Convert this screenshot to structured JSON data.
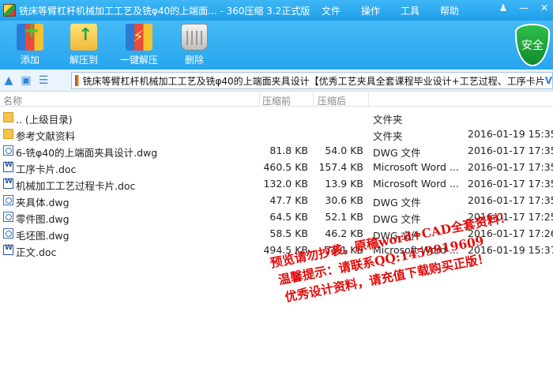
{
  "window": {
    "title": "铣床等臂杠杆机械加工工艺及铣φ40的上端面... - 360压缩 3.2正式版",
    "menu": [
      "文件",
      "操作",
      "工具",
      "帮助"
    ]
  },
  "toolbar": {
    "buttons": [
      {
        "label": "添加",
        "icon": "add-archive-icon"
      },
      {
        "label": "解压到",
        "icon": "extract-icon"
      },
      {
        "label": "一键解压",
        "icon": "one-click-extract-icon"
      },
      {
        "label": "删除",
        "icon": "trash-icon"
      }
    ],
    "shield_label": "安全"
  },
  "address": {
    "path": "铣床等臂杠杆机械加工工艺及铣φ40的上端面夹具设计【优秀工艺夹具全套课程毕业设计+工艺过程、工序卡片",
    "arrow": "V"
  },
  "columns": {
    "name": "名称",
    "size": "压缩前",
    "packed": "压缩后"
  },
  "files": [
    {
      "name": ".. (上级目录)",
      "size": "",
      "packed": "",
      "type": "文件夹",
      "date": "",
      "icon": "folder"
    },
    {
      "name": "参考文献资料",
      "size": "",
      "packed": "",
      "type": "文件夹",
      "date": "2016-01-19 15:35",
      "icon": "folder"
    },
    {
      "name": "6-铣φ40的上端面夹具设计.dwg",
      "size": "81.8 KB",
      "packed": "54.0 KB",
      "type": "DWG 文件",
      "date": "2016-01-17 17:35",
      "icon": "dwg"
    },
    {
      "name": "工序卡片.doc",
      "size": "460.5 KB",
      "packed": "157.4 KB",
      "type": "Microsoft Word ...",
      "date": "2016-01-17 17:35",
      "icon": "doc"
    },
    {
      "name": "机械加工工艺过程卡片.doc",
      "size": "132.0 KB",
      "packed": "13.9 KB",
      "type": "Microsoft Word ...",
      "date": "2016-01-17 17:35",
      "icon": "doc"
    },
    {
      "name": "夹具体.dwg",
      "size": "47.7 KB",
      "packed": "30.6 KB",
      "type": "DWG 文件",
      "date": "2016-01-17 17:35",
      "icon": "dwg"
    },
    {
      "name": "零件图.dwg",
      "size": "64.5 KB",
      "packed": "52.1 KB",
      "type": "DWG 文件",
      "date": "2016-01-17 17:25",
      "icon": "dwg"
    },
    {
      "name": "毛坯图.dwg",
      "size": "58.5 KB",
      "packed": "46.2 KB",
      "type": "DWG 文件",
      "date": "2016-01-17 17:26",
      "icon": "dwg"
    },
    {
      "name": "正文.doc",
      "size": "494.5 KB",
      "packed": "71.1 KB",
      "type": "Microsoft Word ...",
      "date": "2016-01-19 15:37",
      "icon": "doc"
    }
  ],
  "watermark": {
    "line1": "预览请勿抄袭，原稿word+CAD全套资料！",
    "line2": "温馨提示：请联系QQ:1459919609",
    "line3": "优秀设计资料，请充值下载购买正版！"
  }
}
